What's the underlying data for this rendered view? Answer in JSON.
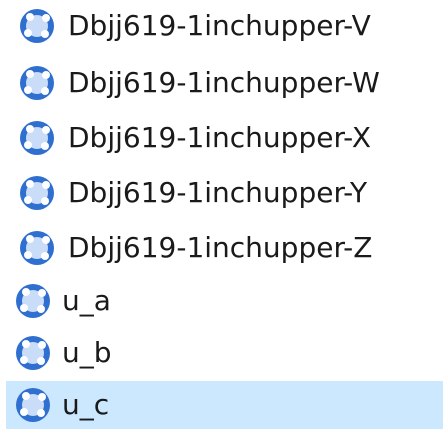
{
  "items": [
    {
      "label": "Dbjj619-1inchupper-V",
      "icon": "shape-file-icon",
      "selected": false
    },
    {
      "label": "Dbjj619-1inchupper-W",
      "icon": "shape-file-icon",
      "selected": false
    },
    {
      "label": "Dbjj619-1inchupper-X",
      "icon": "shape-file-icon",
      "selected": false
    },
    {
      "label": "Dbjj619-1inchupper-Y",
      "icon": "shape-file-icon",
      "selected": false
    },
    {
      "label": "Dbjj619-1inchupper-Z",
      "icon": "shape-file-icon",
      "selected": false
    },
    {
      "label": "u_a",
      "icon": "shape-file-icon",
      "selected": false
    },
    {
      "label": "u_b",
      "icon": "shape-file-icon",
      "selected": false
    },
    {
      "label": "u_c",
      "icon": "shape-file-icon",
      "selected": true
    }
  ],
  "colors": {
    "selection_background": "#cce8ff",
    "text": "#1a1a1a",
    "icon_outer": "#2f6fd0",
    "icon_inner": "#c9dcf8"
  }
}
